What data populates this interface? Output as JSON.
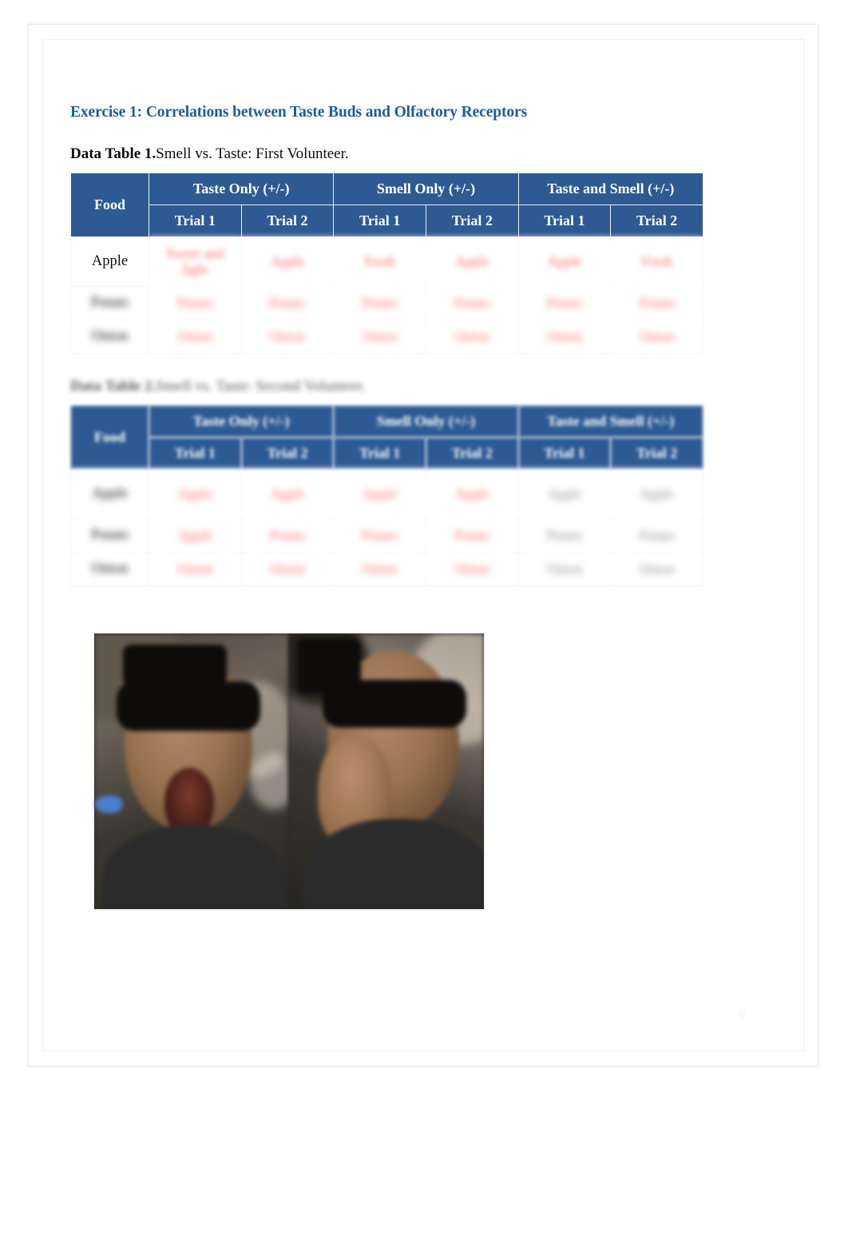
{
  "document": {
    "exercise_heading": "Exercise 1: Correlations between Taste Buds and Olfactory Receptors",
    "page_number": "1"
  },
  "table1": {
    "caption_lead": "Data Table 1.",
    "caption_rest": "Smell vs. Taste: First Volunteer.",
    "headers": {
      "food": "Food",
      "group_taste_only": "Taste Only (+/-)",
      "group_smell_only": "Smell Only (+/-)",
      "group_taste_and_smell": "Taste and Smell (+/-)",
      "trial1": "Trial 1",
      "trial2": "Trial 2"
    },
    "rows": [
      {
        "food": "Apple",
        "food_blurred": false,
        "cells": [
          {
            "text": "Sweet and\nlight",
            "style": "red",
            "blur": "med",
            "two_line": true
          },
          {
            "text": "Apple",
            "style": "red",
            "blur": "med"
          },
          {
            "text": "Fresh",
            "style": "red",
            "blur": "med"
          },
          {
            "text": "Apple",
            "style": "red",
            "blur": "med"
          },
          {
            "text": "Apple",
            "style": "red",
            "blur": "med"
          },
          {
            "text": "Fresh",
            "style": "red",
            "blur": "med"
          }
        ]
      },
      {
        "food": "Potato",
        "food_blurred": true,
        "cells": [
          {
            "text": "Potato",
            "style": "red",
            "blur": "strong"
          },
          {
            "text": "Potato",
            "style": "red",
            "blur": "strong"
          },
          {
            "text": "Potato",
            "style": "red",
            "blur": "strong"
          },
          {
            "text": "Potato",
            "style": "red",
            "blur": "strong"
          },
          {
            "text": "Potato",
            "style": "red",
            "blur": "strong"
          },
          {
            "text": "Potato",
            "style": "red",
            "blur": "strong"
          }
        ]
      },
      {
        "food": "Onion",
        "food_blurred": true,
        "cells": [
          {
            "text": "Onion",
            "style": "red",
            "blur": "strong"
          },
          {
            "text": "Onion",
            "style": "red",
            "blur": "strong"
          },
          {
            "text": "Onion",
            "style": "red",
            "blur": "strong"
          },
          {
            "text": "Onion",
            "style": "red",
            "blur": "strong"
          },
          {
            "text": "Onion",
            "style": "red",
            "blur": "strong"
          },
          {
            "text": "Onion",
            "style": "red",
            "blur": "strong"
          }
        ]
      }
    ]
  },
  "table2": {
    "caption_lead": "Data Table 2.",
    "caption_rest": "Smell vs. Taste: Second Volunteer.",
    "headers": {
      "food": "Food",
      "group_taste_only": "Taste Only (+/-)",
      "group_smell_only": "Smell Only (+/-)",
      "group_taste_and_smell": "Taste and Smell (+/-)",
      "trial1": "Trial 1",
      "trial2": "Trial 2"
    },
    "rows": [
      {
        "food": "Apple",
        "food_blurred": true,
        "cells": [
          {
            "text": "Apple",
            "style": "red",
            "blur": "strong"
          },
          {
            "text": "Apple",
            "style": "red",
            "blur": "strong"
          },
          {
            "text": "Apple",
            "style": "red",
            "blur": "strong"
          },
          {
            "text": "Apple",
            "style": "red",
            "blur": "strong"
          },
          {
            "text": "Apple",
            "style": "gray",
            "blur": "strong"
          },
          {
            "text": "Apple",
            "style": "gray",
            "blur": "strong"
          }
        ]
      },
      {
        "food": "Potato",
        "food_blurred": true,
        "cells": [
          {
            "text": "Apple",
            "style": "red",
            "blur": "strong"
          },
          {
            "text": "Potato",
            "style": "red",
            "blur": "strong"
          },
          {
            "text": "Potato",
            "style": "red",
            "blur": "strong"
          },
          {
            "text": "Potato",
            "style": "red",
            "blur": "strong"
          },
          {
            "text": "Potato",
            "style": "gray",
            "blur": "strong"
          },
          {
            "text": "Potato",
            "style": "gray",
            "blur": "strong"
          }
        ]
      },
      {
        "food": "Onion",
        "food_blurred": true,
        "cells": [
          {
            "text": "Onion",
            "style": "red",
            "blur": "strong"
          },
          {
            "text": "Onion",
            "style": "red",
            "blur": "strong"
          },
          {
            "text": "Onion",
            "style": "red",
            "blur": "strong"
          },
          {
            "text": "Onion",
            "style": "red",
            "blur": "strong"
          },
          {
            "text": "Onion",
            "style": "gray",
            "blur": "strong"
          },
          {
            "text": "Onion",
            "style": "gray",
            "blur": "strong"
          }
        ]
      }
    ]
  },
  "photo": {
    "alt": "Two blindfolded volunteers tasting and smelling food samples",
    "left_caption": "",
    "right_caption": ""
  },
  "colors": {
    "heading_blue": "#1f5c99",
    "table_header_blue": "#2e5a93",
    "red_text": "#ff6a6a",
    "gray_text": "#8d8d8d"
  }
}
